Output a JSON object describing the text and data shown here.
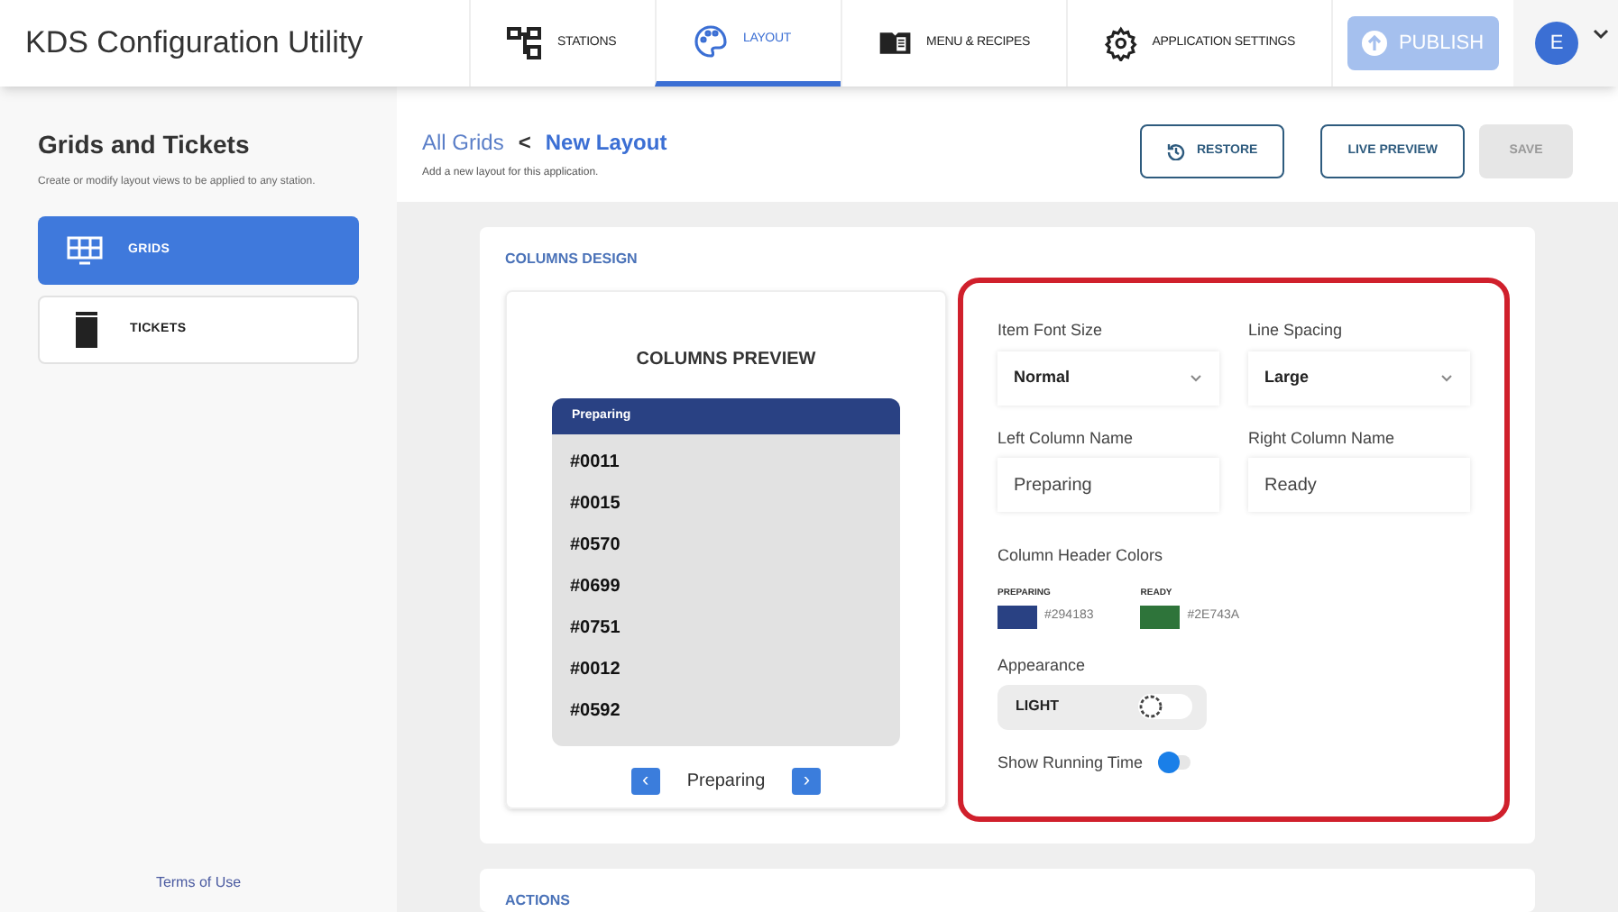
{
  "app": {
    "title": "KDS Configuration Utility"
  },
  "nav_tabs": [
    {
      "label": "STATIONS",
      "selected": false
    },
    {
      "label": "LAYOUT",
      "selected": true
    },
    {
      "label": "MENU & RECIPES",
      "selected": false
    },
    {
      "label": "APPLICATION SETTINGS",
      "selected": false
    }
  ],
  "publish_button": {
    "label": "PUBLISH",
    "disabled": true
  },
  "user": {
    "initial": "E"
  },
  "sidebar": {
    "title": "Grids and Tickets",
    "subtitle": "Create or modify layout views to be applied to any station.",
    "items": [
      {
        "label": "GRIDS",
        "selected": true
      },
      {
        "label": "TICKETS",
        "selected": false
      }
    ],
    "footer_link": "Terms of Use"
  },
  "breadcrumb": {
    "parent": "All Grids",
    "separator": "<",
    "current": "New Layout",
    "subtitle": "Add a new layout for this application."
  },
  "actions": [
    {
      "label": "RESTORE",
      "disabled": false
    },
    {
      "label": "LIVE PREVIEW",
      "disabled": false
    },
    {
      "label": "SAVE",
      "disabled": true
    }
  ],
  "columns_design": {
    "title": "COLUMNS DESIGN",
    "preview": {
      "title": "COLUMNS PREVIEW",
      "header": "Preparing",
      "header_color": "#294183",
      "items": [
        "#0011",
        "#0015",
        "#0570",
        "#0699",
        "#0751",
        "#0012",
        "#0592"
      ],
      "prev": "‹",
      "label": "Preparing",
      "next": "›"
    },
    "selects": [
      {
        "label": "Item Font Size",
        "value": "Normal"
      },
      {
        "label": "Line Spacing",
        "value": "Large"
      }
    ],
    "inputs": [
      {
        "label": "Left Column Name",
        "value": "Preparing"
      },
      {
        "label": "Right Column Name",
        "value": "Ready"
      }
    ],
    "header_colors": {
      "label": "Column Header Colors",
      "items": [
        {
          "name": "PREPARING",
          "color": "#294183"
        },
        {
          "name": "READY",
          "color": "#2E743A"
        }
      ]
    },
    "appearance": {
      "label": "Appearance",
      "value": "LIGHT",
      "dark": false
    },
    "running_time": {
      "label": "Show Running Time",
      "on": false
    }
  },
  "next_section": {
    "title": "ACTIONS"
  }
}
